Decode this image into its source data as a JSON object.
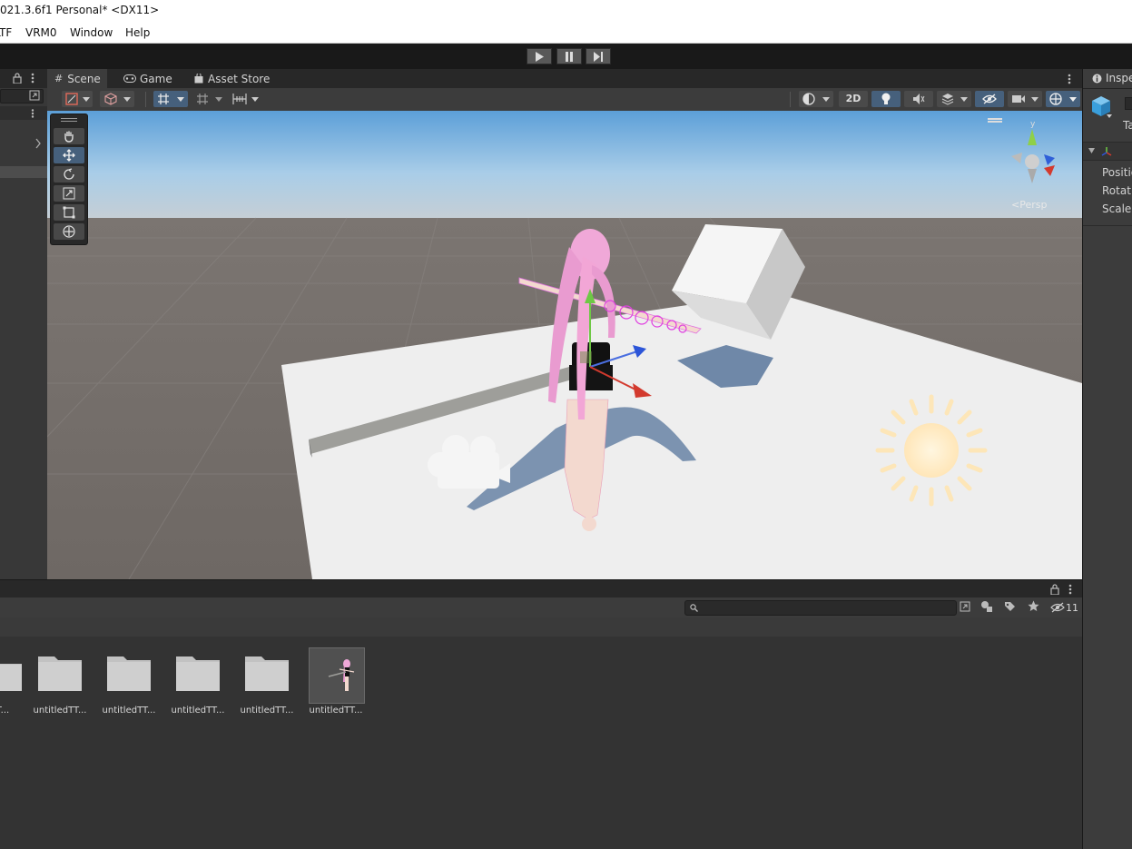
{
  "window": {
    "title": "021.3.6f1 Personal* <DX11>"
  },
  "menu": {
    "items": [
      "LTF",
      "VRM0",
      "Window",
      "Help"
    ]
  },
  "scene_view": {
    "tabs": [
      {
        "label": "Scene",
        "icon": "hash-icon"
      },
      {
        "label": "Game",
        "icon": "gamepad-icon"
      },
      {
        "label": "Asset Store",
        "icon": "shopping-bag-icon"
      }
    ],
    "toggle_2d_label": "2D",
    "gizmo_labels": {
      "y": "y",
      "persp": "<Persp"
    }
  },
  "inspector": {
    "tab_label": "Inspe",
    "object_name_prefix": "Ta",
    "transform_rows": [
      "Positio",
      "Rotatio",
      "Scale"
    ]
  },
  "project": {
    "hidden_count": "11",
    "assets": [
      {
        "label": "TT...",
        "type": "folder"
      },
      {
        "label": "untitledTT...",
        "type": "folder"
      },
      {
        "label": "untitledTT...",
        "type": "folder"
      },
      {
        "label": "untitledTT...",
        "type": "folder"
      },
      {
        "label": "untitledTT...",
        "type": "folder"
      },
      {
        "label": "untitledTT...",
        "type": "prefab"
      }
    ]
  },
  "colors": {
    "accent": "#46607c",
    "panel": "#383838",
    "dark": "#191919",
    "sky_top": "#5a9fd6",
    "ground": "#6b6561",
    "hair": "#f0a8d8"
  }
}
